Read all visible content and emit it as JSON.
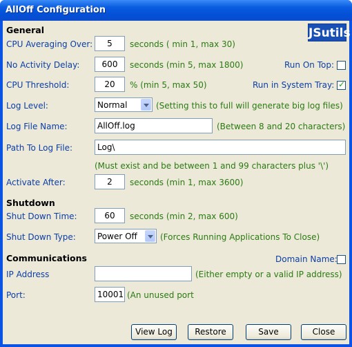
{
  "window": {
    "title": "AllOff Configuration"
  },
  "logo": {
    "text": "JSutils"
  },
  "general": {
    "heading": "General",
    "cpu_avg": {
      "label": "CPU Averaging Over:",
      "value": "5",
      "hint": "seconds ( min 1, max 30)"
    },
    "no_activity": {
      "label": "No Activity Delay:",
      "value": "600",
      "hint": "seconds (min 5, max 1800)"
    },
    "cpu_threshold": {
      "label": "CPU Threshold:",
      "value": "20",
      "hint": "% (min 5, max 50)"
    },
    "run_on_top": {
      "label": "Run On Top:",
      "checked": false
    },
    "run_in_tray": {
      "label": "Run in System Tray:",
      "checked": true
    },
    "log_level": {
      "label": "Log Level:",
      "value": "Normal",
      "hint": "(Setting this to full will generate big log files)"
    },
    "log_file": {
      "label": "Log File Name:",
      "value": "AllOff.log",
      "hint": "(Between 8 and 20 characters)"
    },
    "log_path": {
      "label": "Path To Log File:",
      "value": "Log\\",
      "hint": "(Must exist and be between 1 and 99 characters plus '\\')"
    },
    "activate_after": {
      "label": "Activate After:",
      "value": "2",
      "hint": "seconds (min 1, max 3600)"
    }
  },
  "shutdown": {
    "heading": "Shutdown",
    "time": {
      "label": "Shut Down Time:",
      "value": "60",
      "hint": "seconds (min 2, max 600)"
    },
    "type": {
      "label": "Shut Down Type:",
      "value": "Power Off",
      "hint": "(Forces Running Applications To Close)"
    }
  },
  "communications": {
    "heading": "Communications",
    "domain_name": {
      "label": "Domain Name:",
      "checked": false
    },
    "ip": {
      "label": "IP Address",
      "value": "",
      "hint": "(Either empty or a valid IP address)"
    },
    "port": {
      "label": "Port:",
      "value": "10001",
      "hint": "(An unused port"
    }
  },
  "buttons": {
    "view_log": "View Log",
    "restore": "Restore",
    "save": "Save",
    "close": "Close"
  }
}
